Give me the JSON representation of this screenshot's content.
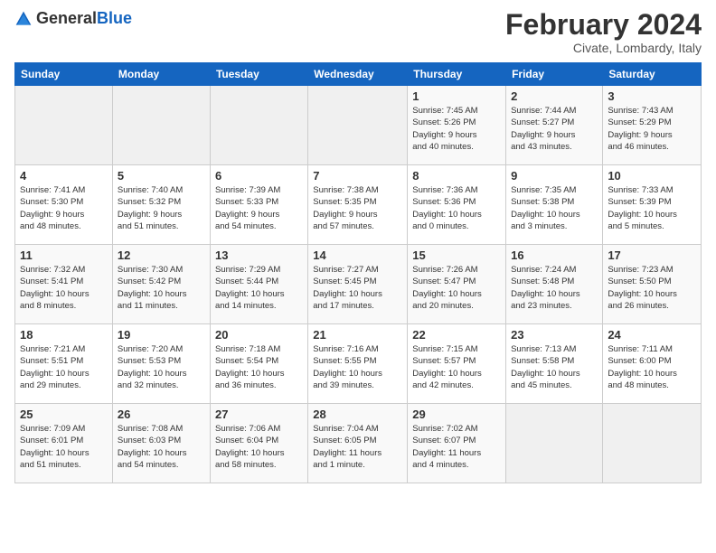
{
  "header": {
    "logo_general": "General",
    "logo_blue": "Blue",
    "month": "February 2024",
    "location": "Civate, Lombardy, Italy"
  },
  "days_of_week": [
    "Sunday",
    "Monday",
    "Tuesday",
    "Wednesday",
    "Thursday",
    "Friday",
    "Saturday"
  ],
  "weeks": [
    [
      {
        "day": "",
        "info": ""
      },
      {
        "day": "",
        "info": ""
      },
      {
        "day": "",
        "info": ""
      },
      {
        "day": "",
        "info": ""
      },
      {
        "day": "1",
        "info": "Sunrise: 7:45 AM\nSunset: 5:26 PM\nDaylight: 9 hours\nand 40 minutes."
      },
      {
        "day": "2",
        "info": "Sunrise: 7:44 AM\nSunset: 5:27 PM\nDaylight: 9 hours\nand 43 minutes."
      },
      {
        "day": "3",
        "info": "Sunrise: 7:43 AM\nSunset: 5:29 PM\nDaylight: 9 hours\nand 46 minutes."
      }
    ],
    [
      {
        "day": "4",
        "info": "Sunrise: 7:41 AM\nSunset: 5:30 PM\nDaylight: 9 hours\nand 48 minutes."
      },
      {
        "day": "5",
        "info": "Sunrise: 7:40 AM\nSunset: 5:32 PM\nDaylight: 9 hours\nand 51 minutes."
      },
      {
        "day": "6",
        "info": "Sunrise: 7:39 AM\nSunset: 5:33 PM\nDaylight: 9 hours\nand 54 minutes."
      },
      {
        "day": "7",
        "info": "Sunrise: 7:38 AM\nSunset: 5:35 PM\nDaylight: 9 hours\nand 57 minutes."
      },
      {
        "day": "8",
        "info": "Sunrise: 7:36 AM\nSunset: 5:36 PM\nDaylight: 10 hours\nand 0 minutes."
      },
      {
        "day": "9",
        "info": "Sunrise: 7:35 AM\nSunset: 5:38 PM\nDaylight: 10 hours\nand 3 minutes."
      },
      {
        "day": "10",
        "info": "Sunrise: 7:33 AM\nSunset: 5:39 PM\nDaylight: 10 hours\nand 5 minutes."
      }
    ],
    [
      {
        "day": "11",
        "info": "Sunrise: 7:32 AM\nSunset: 5:41 PM\nDaylight: 10 hours\nand 8 minutes."
      },
      {
        "day": "12",
        "info": "Sunrise: 7:30 AM\nSunset: 5:42 PM\nDaylight: 10 hours\nand 11 minutes."
      },
      {
        "day": "13",
        "info": "Sunrise: 7:29 AM\nSunset: 5:44 PM\nDaylight: 10 hours\nand 14 minutes."
      },
      {
        "day": "14",
        "info": "Sunrise: 7:27 AM\nSunset: 5:45 PM\nDaylight: 10 hours\nand 17 minutes."
      },
      {
        "day": "15",
        "info": "Sunrise: 7:26 AM\nSunset: 5:47 PM\nDaylight: 10 hours\nand 20 minutes."
      },
      {
        "day": "16",
        "info": "Sunrise: 7:24 AM\nSunset: 5:48 PM\nDaylight: 10 hours\nand 23 minutes."
      },
      {
        "day": "17",
        "info": "Sunrise: 7:23 AM\nSunset: 5:50 PM\nDaylight: 10 hours\nand 26 minutes."
      }
    ],
    [
      {
        "day": "18",
        "info": "Sunrise: 7:21 AM\nSunset: 5:51 PM\nDaylight: 10 hours\nand 29 minutes."
      },
      {
        "day": "19",
        "info": "Sunrise: 7:20 AM\nSunset: 5:53 PM\nDaylight: 10 hours\nand 32 minutes."
      },
      {
        "day": "20",
        "info": "Sunrise: 7:18 AM\nSunset: 5:54 PM\nDaylight: 10 hours\nand 36 minutes."
      },
      {
        "day": "21",
        "info": "Sunrise: 7:16 AM\nSunset: 5:55 PM\nDaylight: 10 hours\nand 39 minutes."
      },
      {
        "day": "22",
        "info": "Sunrise: 7:15 AM\nSunset: 5:57 PM\nDaylight: 10 hours\nand 42 minutes."
      },
      {
        "day": "23",
        "info": "Sunrise: 7:13 AM\nSunset: 5:58 PM\nDaylight: 10 hours\nand 45 minutes."
      },
      {
        "day": "24",
        "info": "Sunrise: 7:11 AM\nSunset: 6:00 PM\nDaylight: 10 hours\nand 48 minutes."
      }
    ],
    [
      {
        "day": "25",
        "info": "Sunrise: 7:09 AM\nSunset: 6:01 PM\nDaylight: 10 hours\nand 51 minutes."
      },
      {
        "day": "26",
        "info": "Sunrise: 7:08 AM\nSunset: 6:03 PM\nDaylight: 10 hours\nand 54 minutes."
      },
      {
        "day": "27",
        "info": "Sunrise: 7:06 AM\nSunset: 6:04 PM\nDaylight: 10 hours\nand 58 minutes."
      },
      {
        "day": "28",
        "info": "Sunrise: 7:04 AM\nSunset: 6:05 PM\nDaylight: 11 hours\nand 1 minute."
      },
      {
        "day": "29",
        "info": "Sunrise: 7:02 AM\nSunset: 6:07 PM\nDaylight: 11 hours\nand 4 minutes."
      },
      {
        "day": "",
        "info": ""
      },
      {
        "day": "",
        "info": ""
      }
    ]
  ]
}
